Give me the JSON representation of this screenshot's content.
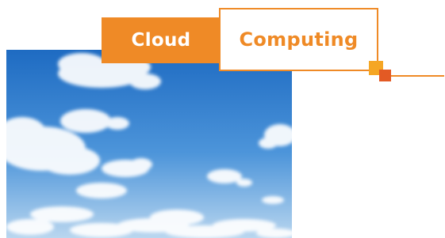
{
  "title": {
    "word1": "Cloud",
    "word2": "Computing"
  },
  "colors": {
    "accent_orange": "#ef8a26",
    "accent_red": "#e35a24",
    "accent_yellow": "#f5a624",
    "sky_top": "#1f6fc4",
    "sky_bottom": "#b7d5ef"
  },
  "image": {
    "subject": "sky-with-clouds"
  }
}
